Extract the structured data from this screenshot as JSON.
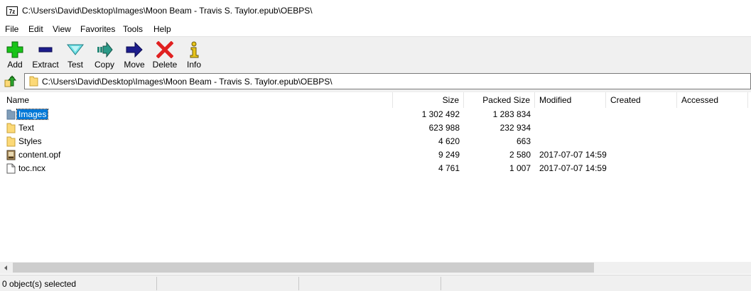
{
  "window": {
    "app_icon_text": "7z",
    "title": "C:\\Users\\David\\Desktop\\Images\\Moon Beam - Travis S. Taylor.epub\\OEBPS\\"
  },
  "menu": [
    "File",
    "Edit",
    "View",
    "Favorites",
    "Tools",
    "Help"
  ],
  "toolbar": {
    "add": "Add",
    "extract": "Extract",
    "test": "Test",
    "copy": "Copy",
    "move": "Move",
    "delete": "Delete",
    "info": "Info"
  },
  "address": {
    "path": "C:\\Users\\David\\Desktop\\Images\\Moon Beam - Travis S. Taylor.epub\\OEBPS\\"
  },
  "columns": {
    "name": "Name",
    "size": "Size",
    "packed": "Packed Size",
    "modified": "Modified",
    "created": "Created",
    "accessed": "Accessed"
  },
  "files": [
    {
      "name": "Images",
      "size": "1 302 492",
      "packed": "1 283 834",
      "modified": "",
      "icon": "folder-selected-icon"
    },
    {
      "name": "Text",
      "size": "623 988",
      "packed": "232 934",
      "modified": "",
      "icon": "folder-icon"
    },
    {
      "name": "Styles",
      "size": "4 620",
      "packed": "663",
      "modified": "",
      "icon": "folder-icon"
    },
    {
      "name": "content.opf",
      "size": "9 249",
      "packed": "2 580",
      "modified": "2017-07-07 14:59",
      "icon": "opf-file-icon"
    },
    {
      "name": "toc.ncx",
      "size": "4 761",
      "packed": "1 007",
      "modified": "2017-07-07 14:59",
      "icon": "file-icon"
    }
  ],
  "status": {
    "selection": "0 object(s) selected"
  },
  "colors": {
    "selection": "#0078d7",
    "folder": "#fcd977",
    "add_green": "#19c419",
    "delete_red": "#e02020",
    "nav_blue": "#1d1d8c"
  }
}
